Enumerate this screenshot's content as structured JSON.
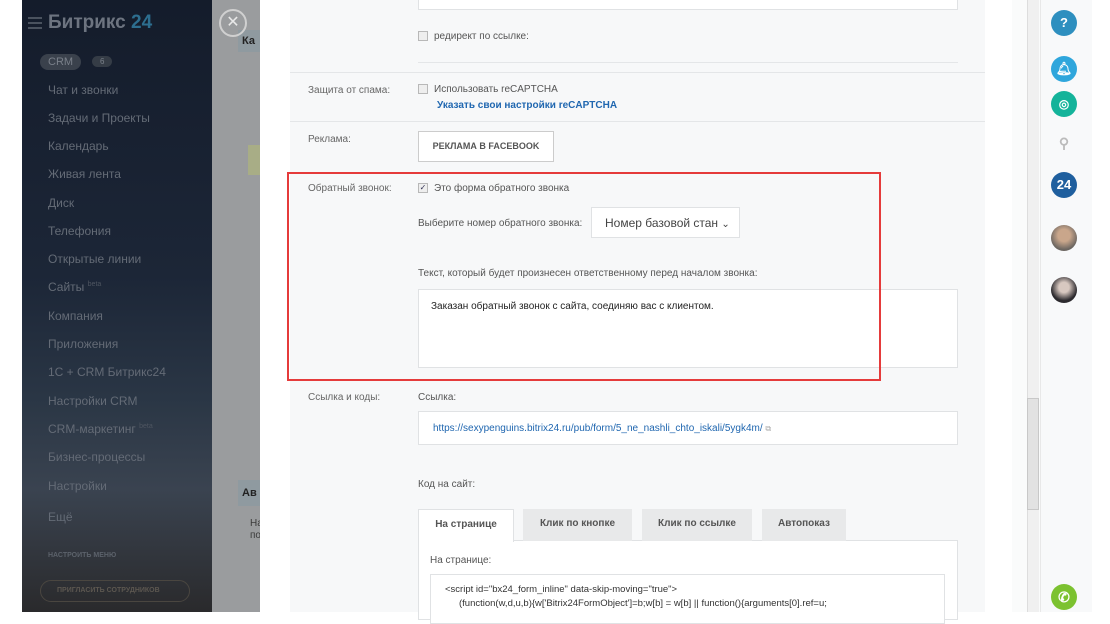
{
  "sidebar": {
    "logo_text": "Битрикс",
    "logo_num": "24",
    "crm_label": "CRM",
    "crm_count": "6",
    "items": [
      "Чат и звонки",
      "Задачи и Проекты",
      "Календарь",
      "Живая лента",
      "Диск",
      "Телефония",
      "Открытые линии",
      "Сайты",
      "Компания",
      "Приложения",
      "1С + CRM Битрикс24",
      "Настройки CRM",
      "CRM-маркетинг",
      "Бизнес-процессы",
      "Настройки",
      "Ещё"
    ],
    "beta": "beta",
    "configure_menu": "НАСТРОИТЬ МЕНЮ",
    "invite": "ПРИГЛАСИТЬ СОТРУДНИКОВ"
  },
  "overlay": {
    "block1": "Ка",
    "block2": "Ав",
    "text2": "На по"
  },
  "form": {
    "redirect_label": "редирект по ссылке:",
    "spam_label": "Защита от спама:",
    "recaptcha_label": "Использовать reCAPTCHA",
    "recaptcha_link": "Указать свои настройки reCAPTCHA",
    "ads_label": "Реклама:",
    "facebook_button": "РЕКЛАМА В FACEBOOK",
    "callback_label": "Обратный звонок:",
    "callback_checkbox": "Это форма обратного звонка",
    "callback_checked": true,
    "number_label": "Выберите номер обратного звонка:",
    "number_value": "Номер базовой стан",
    "speech_label": "Текст, который будет произнесен ответственному перед началом звонка:",
    "speech_text": "Заказан обратный звонок с сайта, соединяю вас с клиентом.",
    "links_label": "Ссылка и коды:",
    "link_label": "Ссылка:",
    "link_value": "https://sexypenguins.bitrix24.ru/pub/form/5_ne_nashli_chto_iskali/5ygk4m/",
    "code_label": "Код на сайт:",
    "tabs": [
      "На странице",
      "Клик по кнопке",
      "Клик по ссылке",
      "Автопоказ"
    ],
    "tab_content_label": "На странице:",
    "code_line1": "<script id=\"bx24_form_inline\" data-skip-moving=\"true\">",
    "code_line2": "(function(w,d,u,b){w['Bitrix24FormObject']=b;w[b] = w[b] || function(){arguments[0].ref=u;"
  },
  "rightbar": {
    "help": "?",
    "b24": "24"
  },
  "colors": {
    "accent_red": "#e53b3b",
    "link": "#2067b0",
    "phone": "#7cc230"
  }
}
